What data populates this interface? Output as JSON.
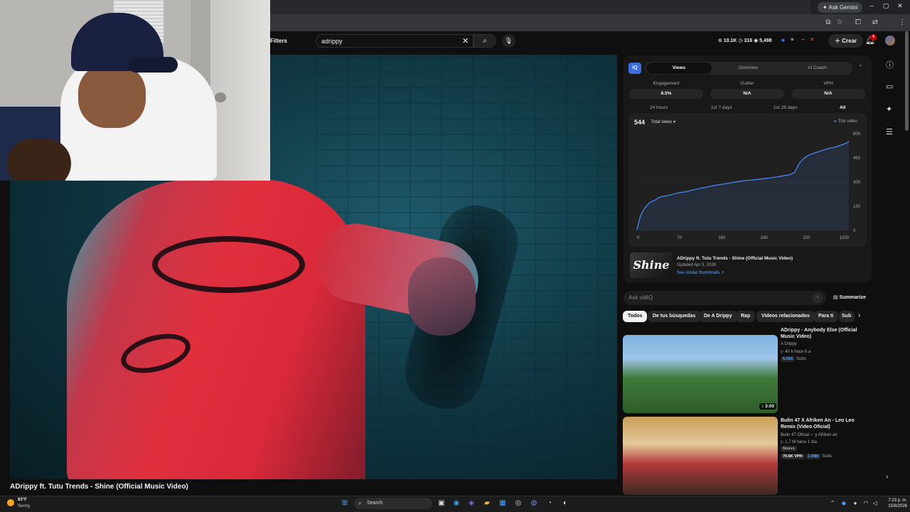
{
  "browser": {
    "ask_gemini": "Ask Gemini",
    "window_controls": [
      "–",
      "▢",
      "✕"
    ]
  },
  "header": {
    "filters_label": "Filters",
    "search_value": "adrippy",
    "stats": "⊙ 10.1K  ◷ 316  ◉ 5,498",
    "create_label": "Crear",
    "notif_count": "9"
  },
  "video": {
    "title": "ADrippy ft. Tutu Trends - Shine (Official Music Video)"
  },
  "vidiq": {
    "logo": "iQ",
    "tabs": [
      "Views",
      "Overview",
      "AI Coach"
    ],
    "metrics": [
      {
        "label": "Engagement",
        "value": "8.5%"
      },
      {
        "label": "Outlier",
        "value": "N/A"
      },
      {
        "label": "VPH",
        "value": "N/A"
      }
    ],
    "ranges": [
      "24 hours",
      "1st 7 days",
      "1st 28 days",
      "All"
    ],
    "total_value": "544",
    "total_select": "Total views ▾",
    "legend": "This video",
    "info_title": "ADrippy ft. Tutu Trends - Shine (Official Music Video)",
    "info_updated": "Updated Apr 3, 2026",
    "info_link": "See similar thumbnails ↗",
    "thumb_text": "Shine",
    "ask_placeholder": "Ask vidIQ",
    "summarize": "Summarize"
  },
  "chart_data": {
    "type": "line",
    "series": [
      {
        "name": "This video",
        "x": [
          0,
          5,
          10,
          15,
          20,
          25,
          30,
          35,
          40,
          45,
          50,
          55,
          60,
          70,
          80,
          90,
          100,
          110,
          120,
          130,
          140,
          150,
          160,
          170,
          180,
          190,
          200,
          210,
          220,
          230,
          240,
          250,
          260,
          270,
          280,
          290,
          300,
          310,
          320,
          325,
          330,
          340,
          350,
          360,
          370,
          380,
          390,
          400,
          410,
          420,
          430
        ],
        "y": [
          5,
          70,
          110,
          135,
          155,
          170,
          180,
          185,
          195,
          205,
          210,
          212,
          215,
          222,
          230,
          236,
          240,
          248,
          255,
          262,
          268,
          275,
          280,
          285,
          290,
          295,
          300,
          305,
          310,
          312,
          315,
          318,
          322,
          325,
          330,
          335,
          340,
          345,
          360,
          390,
          420,
          450,
          470,
          480,
          490,
          500,
          510,
          515,
          525,
          535,
          550
        ]
      }
    ],
    "x_ticks": [
      "0",
      "70",
      "160",
      "240",
      "320",
      "1200"
    ],
    "y_ticks": [
      "600",
      "450",
      "300",
      "150",
      "0"
    ],
    "xlim": [
      0,
      430
    ],
    "ylim": [
      0,
      600
    ]
  },
  "chips": [
    "Todos",
    "De tus búsquedas",
    "De A Drippy",
    "Rap",
    "Videos relacionados",
    "Para ti",
    "Sub"
  ],
  "related": [
    {
      "title": "ADrippy - Anybody Else (Official Music Video)",
      "channel": "A Drippy",
      "meta": "▷ 40 k   hace 6 a",
      "badge_blue": "5.03X",
      "badge_plain": "Subs",
      "duration": "♪ 3:00"
    },
    {
      "title": "Bulin 47 X Afriken An - Leo Leo Remix (Video Oficial)",
      "channel": "Bulin 47 Oficial ✓ y Afriken an",
      "meta": "▷ 1.7 M   hace 1 día",
      "badge_new": "Nuevo",
      "vph": "70.6K VPH",
      "badge_blue": "2.99M",
      "badge_plain": "Subs"
    }
  ],
  "taskbar": {
    "temp": "83°F",
    "condition": "Sunny",
    "search": "Search",
    "time": "7:23 p. m.",
    "date": "15/8/2026"
  }
}
